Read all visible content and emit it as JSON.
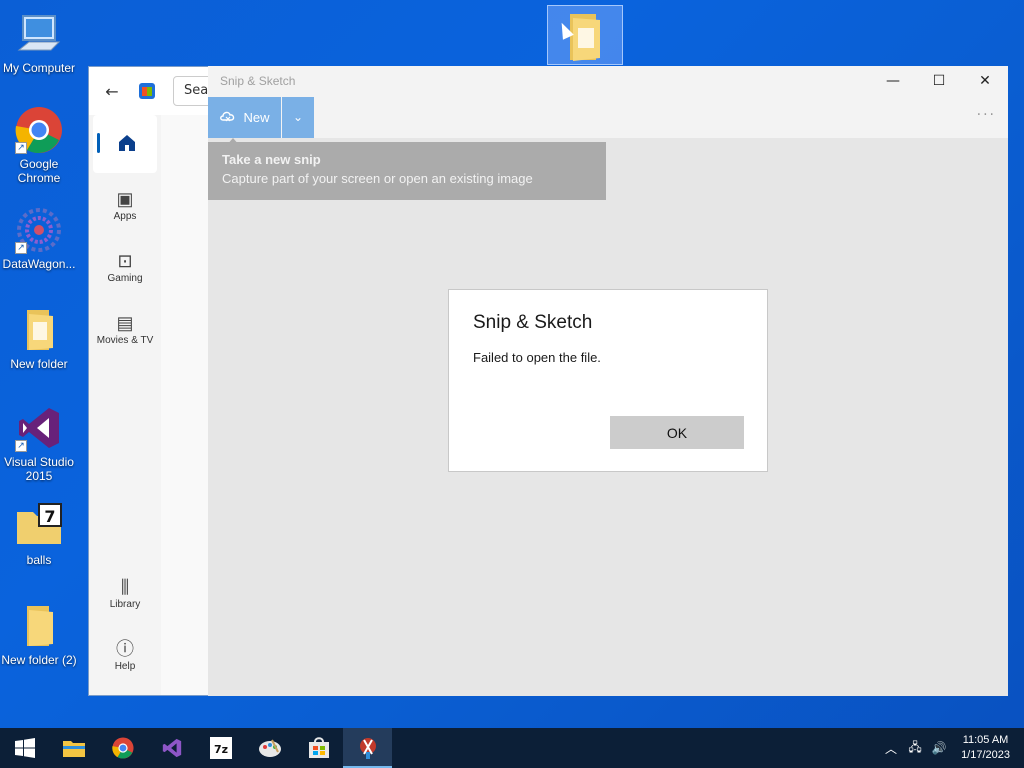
{
  "desktop": {
    "icons": [
      {
        "label": "My Computer"
      },
      {
        "label": "Google Chrome"
      },
      {
        "label": "DataWagon..."
      },
      {
        "label": "New folder"
      },
      {
        "label": "Visual Studio 2015"
      },
      {
        "label": "balls"
      },
      {
        "label": "New folder (2)"
      }
    ]
  },
  "store": {
    "search_text": "Sea",
    "nav": [
      {
        "label": "Apps",
        "icon": "apps-icon"
      },
      {
        "label": "Gaming",
        "icon": "gamepad-icon"
      },
      {
        "label": "Movies & TV",
        "icon": "clapperboard-icon"
      },
      {
        "label": "Library",
        "icon": "library-icon"
      },
      {
        "label": "Help",
        "icon": "help-icon"
      }
    ]
  },
  "snip": {
    "title": "Snip & Sketch",
    "new_label": "New",
    "tooltip_title": "Take a new snip",
    "tooltip_desc": "Capture part of your screen or open an existing image"
  },
  "dialog": {
    "title": "Snip & Sketch",
    "message": "Failed to open the file.",
    "ok_label": "OK"
  },
  "taskbar": {
    "time": "11:05 AM",
    "date": "1/17/2023"
  },
  "colors": {
    "accent": "#005fb8",
    "new_button": "#7ab0e6",
    "taskbar": "#0c1f37"
  }
}
